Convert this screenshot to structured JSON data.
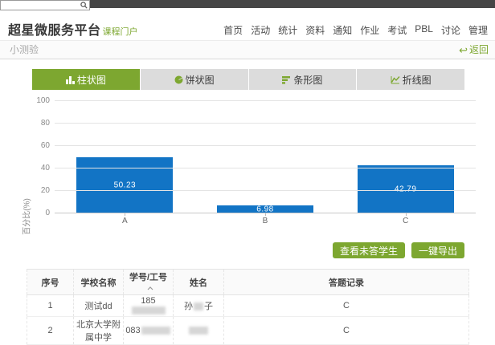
{
  "topbar": {
    "search_value": "",
    "search_icon": "magnifier-icon"
  },
  "header": {
    "brand": "超星微服务平台",
    "brand_sub": "课程门户",
    "nav": [
      "首页",
      "活动",
      "统计",
      "资料",
      "通知",
      "作业",
      "考试",
      "PBL",
      "讨论",
      "管理"
    ]
  },
  "toolbar": {
    "title": "小测验",
    "back_label": "返回",
    "back_icon": "back-arrow-icon"
  },
  "tabs": [
    {
      "id": "bar",
      "label": "柱状图",
      "icon": "bar-chart-icon",
      "active": true
    },
    {
      "id": "pie",
      "label": "饼状图",
      "icon": "pie-chart-icon",
      "active": false
    },
    {
      "id": "hbar",
      "label": "条形图",
      "icon": "hbar-chart-icon",
      "active": false
    },
    {
      "id": "line",
      "label": "折线图",
      "icon": "line-chart-icon",
      "active": false
    }
  ],
  "chart_data": {
    "type": "bar",
    "categories": [
      "A",
      "B",
      "C"
    ],
    "values": [
      50.23,
      6.98,
      42.79
    ],
    "value_labels": [
      "50.23",
      "6.98",
      "42.79"
    ],
    "title": "",
    "xlabel": "",
    "ylabel": "百分比(%)",
    "ylim": [
      0,
      100
    ],
    "yticks": [
      0,
      20,
      40,
      60,
      80,
      100
    ],
    "grid": true,
    "legend": false,
    "bar_color": "#1274c5"
  },
  "actions": {
    "view_unanswered_label": "查看未答学生",
    "export_label": "一键导出"
  },
  "table": {
    "headers": [
      "序号",
      "学校名称",
      "学号/工号",
      "姓名",
      "答题记录"
    ],
    "sorted_column": "学号/工号",
    "sort_direction": "asc",
    "rows": [
      {
        "no": "1",
        "school": "测试dd",
        "id_visible": "185",
        "id_mask_len": 6,
        "name_pre": "孙",
        "name_mask_len": 1,
        "name_post": "子",
        "record": "C"
      },
      {
        "no": "2",
        "school": "北京大学附属中学",
        "id_visible": "083",
        "id_mask_len": 5,
        "name_pre": "",
        "name_mask_len": 3,
        "name_post": "",
        "record": "C"
      }
    ]
  },
  "colors": {
    "accent_green": "#7da730",
    "bar_blue": "#1274c5",
    "topbar_dark": "#464646"
  }
}
